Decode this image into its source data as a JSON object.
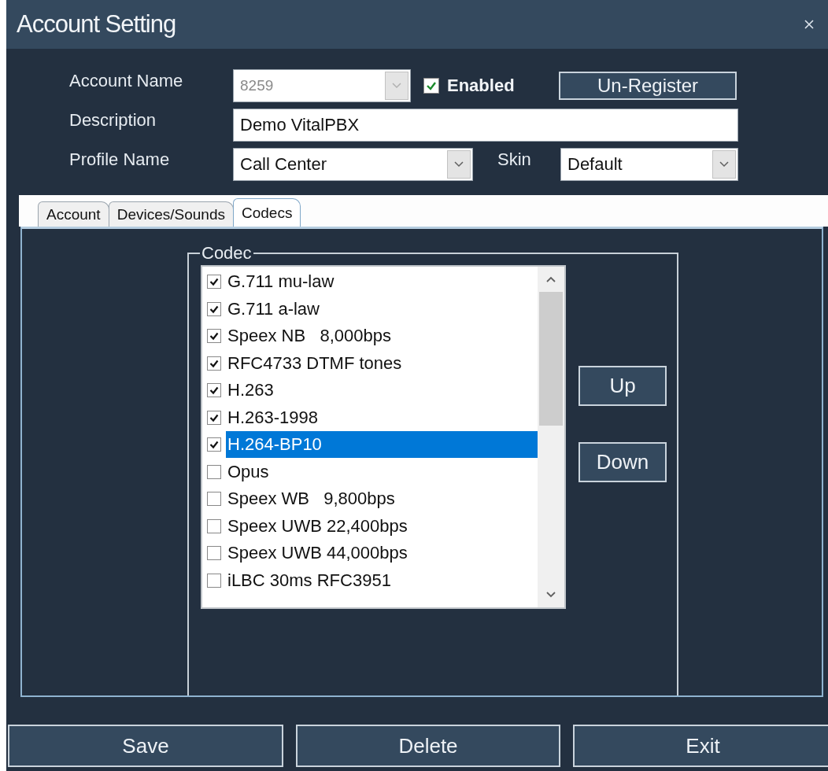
{
  "window": {
    "title": "Account Setting"
  },
  "form": {
    "account_name": {
      "label": "Account Name",
      "value": "8259",
      "disabled": true
    },
    "enabled": {
      "label": "Enabled",
      "checked": true
    },
    "register_button": "Un-Register",
    "description": {
      "label": "Description",
      "value": "Demo VitalPBX"
    },
    "profile": {
      "label": "Profile Name",
      "value": "Call Center"
    },
    "skin": {
      "label": "Skin",
      "value": "Default"
    }
  },
  "tabs": [
    {
      "label": "Account",
      "selected": false
    },
    {
      "label": "Devices/Sounds",
      "selected": false
    },
    {
      "label": "Codecs",
      "selected": true
    }
  ],
  "codec_group": {
    "title": "Codec",
    "codecs": [
      {
        "name": "G.711 mu-law",
        "checked": true,
        "selected": false
      },
      {
        "name": "G.711 a-law",
        "checked": true,
        "selected": false
      },
      {
        "name": "Speex NB   8,000bps",
        "checked": true,
        "selected": false
      },
      {
        "name": "RFC4733 DTMF tones",
        "checked": true,
        "selected": false
      },
      {
        "name": "H.263",
        "checked": true,
        "selected": false
      },
      {
        "name": "H.263-1998",
        "checked": true,
        "selected": false
      },
      {
        "name": "H.264-BP10",
        "checked": true,
        "selected": true
      },
      {
        "name": "Opus",
        "checked": false,
        "selected": false
      },
      {
        "name": "Speex WB   9,800bps",
        "checked": false,
        "selected": false
      },
      {
        "name": "Speex UWB 22,400bps",
        "checked": false,
        "selected": false
      },
      {
        "name": "Speex UWB 44,000bps",
        "checked": false,
        "selected": false
      },
      {
        "name": "iLBC 30ms RFC3951",
        "checked": false,
        "selected": false
      }
    ],
    "move_buttons": [
      "Up",
      "Down"
    ]
  },
  "buttons": [
    "Save",
    "Delete",
    "Exit"
  ]
}
